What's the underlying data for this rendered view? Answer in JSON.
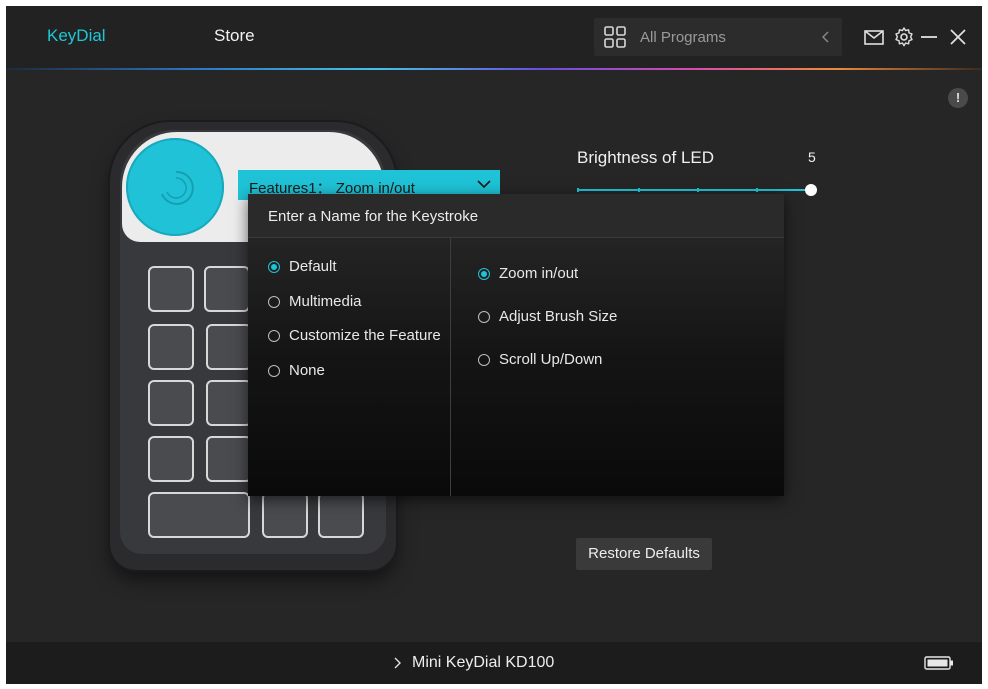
{
  "header": {
    "tabs": [
      {
        "label": "KeyDial",
        "active": true
      },
      {
        "label": "Store",
        "active": false
      }
    ],
    "program_selector": {
      "label": "All Programs"
    },
    "icons": [
      "mail-icon",
      "gear-icon",
      "minimize-icon",
      "close-icon"
    ]
  },
  "info_badge": "!",
  "feature_dropdown": {
    "label": "Features1： Zoom in/out"
  },
  "brightness": {
    "label": "Brightness of LED",
    "value": "5",
    "level": 1.0
  },
  "popup": {
    "title": "Enter a Name for the Keystroke",
    "categories": [
      {
        "label": "Default",
        "selected": true
      },
      {
        "label": "Multimedia",
        "selected": false
      },
      {
        "label": "Customize the Feature",
        "selected": false
      },
      {
        "label": "None",
        "selected": false
      }
    ],
    "features": [
      {
        "label": "Zoom in/out",
        "selected": true
      },
      {
        "label": "Adjust Brush Size",
        "selected": false
      },
      {
        "label": "Scroll Up/Down",
        "selected": false
      }
    ]
  },
  "restore_button": "Restore Defaults",
  "footer": {
    "device_name": "Mini KeyDial KD100"
  },
  "colors": {
    "accent": "#1fc2d6",
    "background": "#262626",
    "titlebar": "#222222"
  }
}
